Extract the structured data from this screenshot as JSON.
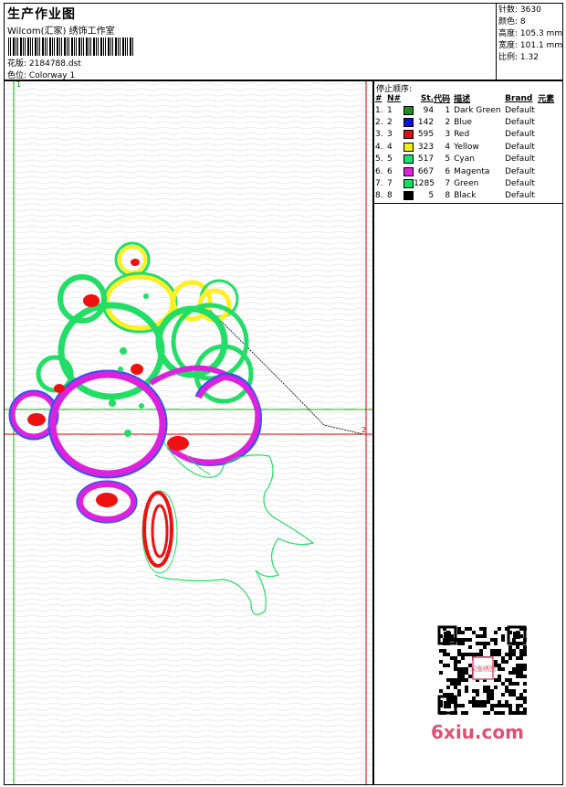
{
  "header": {
    "title": "生产作业图",
    "subtitle": "Wilcom(汇家) 绣饰工作室",
    "design_label": "花版:",
    "design_value": "2184788.dst",
    "colorway_label": "色位:",
    "colorway_value": "Colorway 1"
  },
  "stats": [
    {
      "label": "针数:",
      "value": "3630"
    },
    {
      "label": "颜色:",
      "value": "8"
    },
    {
      "label": "高度:",
      "value": "105.3 mm"
    },
    {
      "label": "宽度:",
      "value": "101.1 mm"
    },
    {
      "label": "比例:",
      "value": "1.32"
    }
  ],
  "canvas": {
    "marker_top": "1",
    "marker_right": "2"
  },
  "stop_sequence": {
    "title": "停止顺序:",
    "headers": [
      "#",
      "N#",
      "St.",
      "代码",
      "描述",
      "Brand",
      "元素"
    ],
    "rows": [
      {
        "idx": "1.",
        "n": "1",
        "color": "#1f8a1f",
        "st": "94",
        "code": "1",
        "desc": "Dark Green",
        "brand": "Default"
      },
      {
        "idx": "2.",
        "n": "2",
        "color": "#1010e0",
        "st": "142",
        "code": "2",
        "desc": "Blue",
        "brand": "Default"
      },
      {
        "idx": "3.",
        "n": "3",
        "color": "#e01010",
        "st": "595",
        "code": "3",
        "desc": "Red",
        "brand": "Default"
      },
      {
        "idx": "4.",
        "n": "4",
        "color": "#f0f010",
        "st": "323",
        "code": "4",
        "desc": "Yellow",
        "brand": "Default"
      },
      {
        "idx": "5.",
        "n": "5",
        "color": "#20e070",
        "st": "517",
        "code": "5",
        "desc": "Cyan",
        "brand": "Default"
      },
      {
        "idx": "6.",
        "n": "6",
        "color": "#e020e0",
        "st": "667",
        "code": "6",
        "desc": "Magenta",
        "brand": "Default"
      },
      {
        "idx": "7.",
        "n": "7",
        "color": "#10e060",
        "st": "1285",
        "code": "7",
        "desc": "Green",
        "brand": "Default"
      },
      {
        "idx": "8.",
        "n": "8",
        "color": "#000000",
        "st": "5",
        "code": "8",
        "desc": "Black",
        "brand": "Default"
      }
    ]
  },
  "watermark": "6xiu.com",
  "qr_stamp": "汉版绣图",
  "colors": {
    "green": "#22dd66",
    "yellow": "#ffee22",
    "magenta": "#dd22dd",
    "blue": "#3355ee",
    "red": "#ee1111",
    "guide_red": "#e00000",
    "guide_green": "#00c000"
  }
}
